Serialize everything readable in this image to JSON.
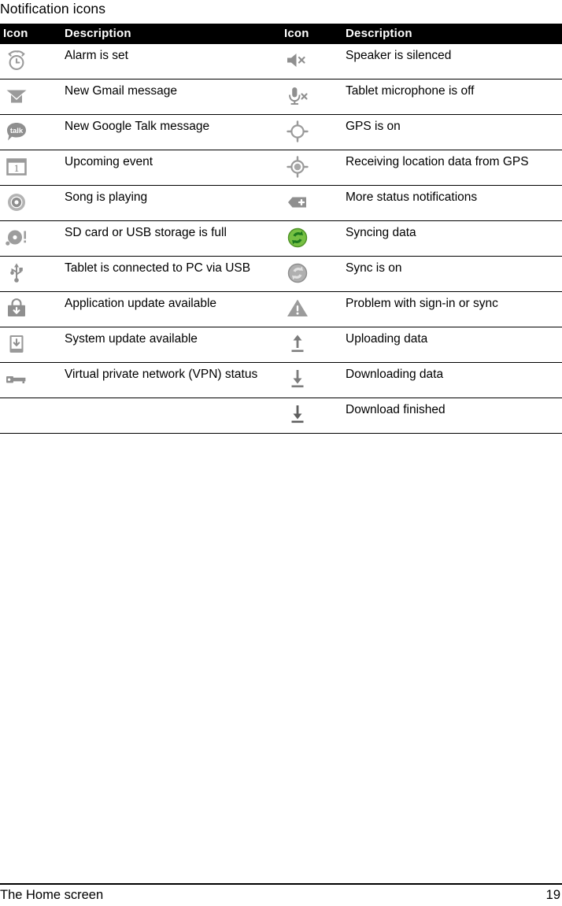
{
  "page": {
    "title": "Notification icons",
    "footer_left": "The Home screen",
    "footer_page_number": "19"
  },
  "table": {
    "headers": [
      "Icon",
      "Description",
      "Icon",
      "Description"
    ],
    "rows": [
      {
        "left_icon": "alarm-clock-icon",
        "left_desc": "Alarm is set",
        "right_icon": "speaker-muted-icon",
        "right_desc": "Speaker is silenced"
      },
      {
        "left_icon": "gmail-envelope-icon",
        "left_desc": "New Gmail message",
        "right_icon": "microphone-off-icon",
        "right_desc": "Tablet microphone is off"
      },
      {
        "left_icon": "google-talk-icon",
        "left_desc": "New Google Talk message",
        "right_icon": "gps-crosshair-icon",
        "right_desc": "GPS is on"
      },
      {
        "left_icon": "calendar-event-icon",
        "left_desc": "Upcoming event",
        "right_icon": "gps-locked-icon",
        "right_desc": "Receiving location data from GPS"
      },
      {
        "left_icon": "music-note-disc-icon",
        "left_desc": "Song is playing",
        "right_icon": "more-notifications-plus-icon",
        "right_desc": "More status notifications"
      },
      {
        "left_icon": "sd-card-full-icon",
        "left_desc": "SD card or USB storage is full",
        "right_icon": "sync-active-icon",
        "right_desc": "Syncing data"
      },
      {
        "left_icon": "usb-icon",
        "left_desc": "Tablet is connected to PC via USB",
        "right_icon": "sync-on-icon",
        "right_desc": "Sync is on"
      },
      {
        "left_icon": "app-update-icon",
        "left_desc": "Application update available",
        "right_icon": "warning-triangle-icon",
        "right_desc": "Problem with sign-in or sync"
      },
      {
        "left_icon": "system-update-icon",
        "left_desc": "System update available",
        "right_icon": "upload-arrow-icon",
        "right_desc": "Uploading data"
      },
      {
        "left_icon": "vpn-key-icon",
        "left_desc": "Virtual private network (VPN) status",
        "right_icon": "download-arrow-icon",
        "right_desc": "Downloading data"
      },
      {
        "left_icon": "",
        "left_desc": "",
        "right_icon": "download-finished-icon",
        "right_desc": "Download finished"
      }
    ]
  },
  "colors": {
    "header_background": "#000000",
    "header_text": "#ffffff",
    "icon_gray": "#9a9a9a",
    "icon_gray_dark": "#6e6e6e",
    "sync_green": "#76c043",
    "rule": "#000000"
  }
}
